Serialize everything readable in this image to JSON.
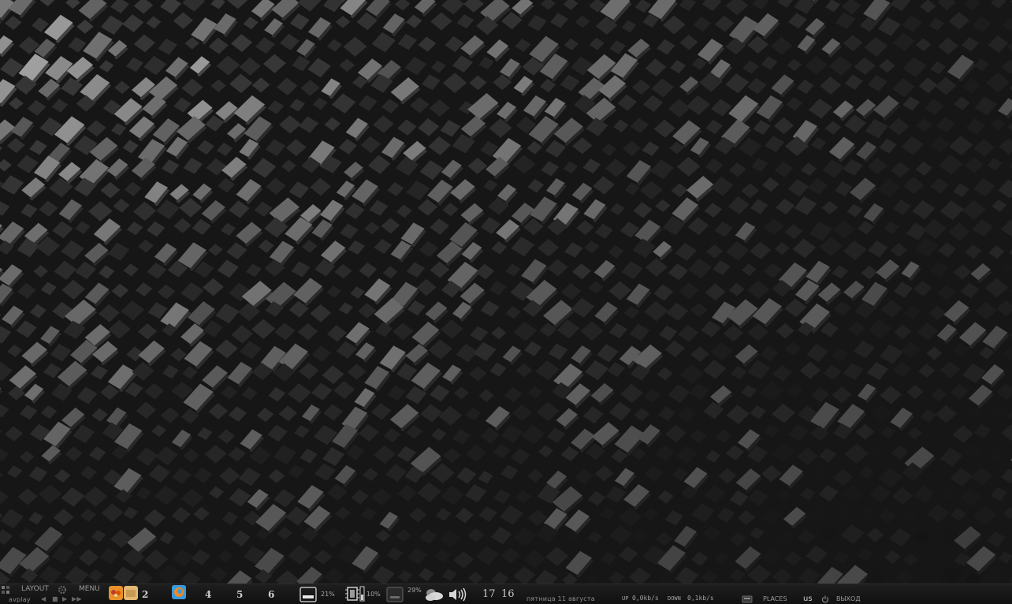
{
  "panel": {
    "layout_label": "LAYOUT",
    "menu_label": "MENU",
    "player_name": "avplay",
    "player_controls": {
      "prev": "◀",
      "stop": "■",
      "play": "▶",
      "next": "▶▶"
    },
    "tags": [
      "2",
      "4",
      "5",
      "6"
    ],
    "indicators": {
      "memory_percent": "21%",
      "cpu_percent": "10%",
      "disk_percent": "29%"
    },
    "clock": {
      "hours": "17",
      "minutes": "16"
    },
    "date": "пятница 11 августа",
    "network": {
      "up_label": "UP",
      "up_value": "0,0kb/s",
      "down_label": "DOWN",
      "down_value": "0,1kb/s"
    },
    "places_label": "PLACES",
    "keyboard_layout": "us",
    "logout_label": "ВЫХОД"
  },
  "icons": {
    "layout": "layout-grid-icon",
    "menu": "gear-icon",
    "app1": "fox-app-icon",
    "app2": "folder-app-icon",
    "app3": "firefox-icon",
    "memory": "memory-icon",
    "cpu": "cpu-chip-icon",
    "disk": "disk-icon",
    "weather": "cloud-icon",
    "volume": "speaker-icon",
    "places": "places-icon",
    "logout": "power-icon"
  },
  "colors": {
    "panel_background": "#151515",
    "panel_text": "#9a9a9a",
    "accent_orange": "#e8902a",
    "accent_blue": "#3a9ad9"
  }
}
